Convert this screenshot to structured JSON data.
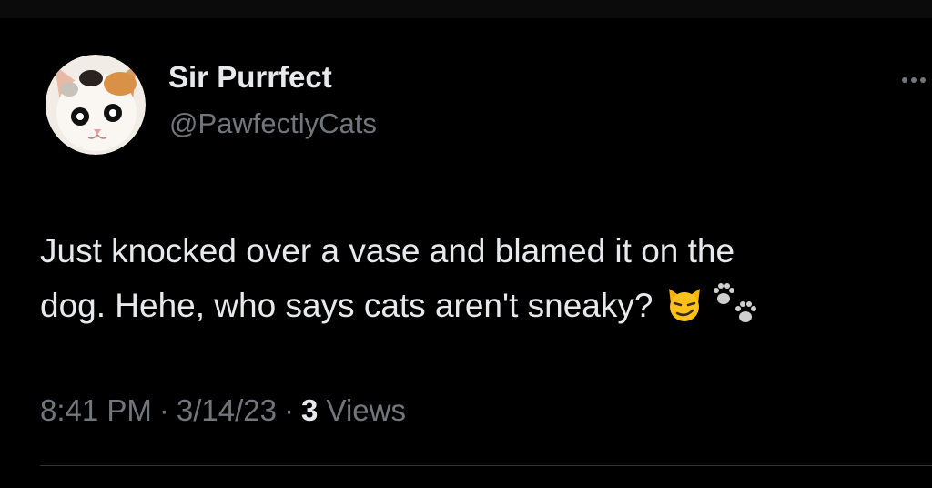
{
  "author": {
    "display_name": "Sir Purrfect",
    "handle": "@PawfectlyCats",
    "avatar_icon": "cat-avatar"
  },
  "tweet": {
    "line1": "Just knocked over a vase and blamed it on the",
    "line2": "dog. Hehe, who says cats aren't sneaky?",
    "emojis": [
      "smirking-cat-emoji",
      "paw-prints-emoji"
    ]
  },
  "meta": {
    "time": "8:41 PM",
    "date": "3/14/23",
    "separator": "·",
    "views_count": "3",
    "views_label": "Views"
  },
  "colors": {
    "background": "#000000",
    "text_primary": "#e7e9ea",
    "text_secondary": "#71767b",
    "divider": "#2f3336"
  }
}
